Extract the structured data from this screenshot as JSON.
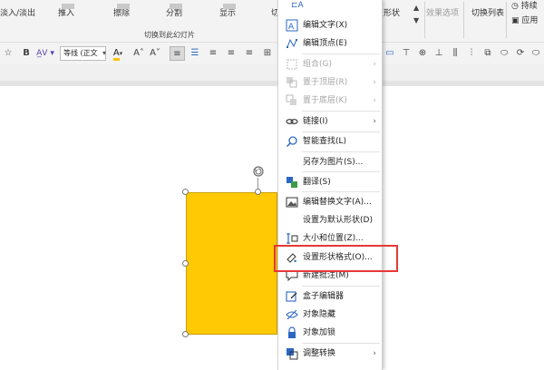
{
  "ribbon": {
    "buttons": [
      "淡入/淡出",
      "推入",
      "擦除",
      "分割",
      "显示",
      "切"
    ],
    "right": {
      "shape_label": "形状",
      "effect_options": "效果选项",
      "switch_list": "切换列表",
      "duration": "持续",
      "apply": "应用"
    },
    "group_label": "切换到此幻灯片"
  },
  "format_bar": {
    "bold": "B",
    "font_name": "等线 (正文",
    "font_color": "A",
    "grow_font": "A˄",
    "shrink_font": "A˅"
  },
  "context_menu": {
    "items": [
      {
        "label": "编辑文字(X)",
        "icon": "edit-text-icon",
        "enabled": true,
        "submenu": false
      },
      {
        "label": "编辑顶点(E)",
        "icon": "edit-points-icon",
        "enabled": true,
        "submenu": false
      },
      {
        "label": "组合(G)",
        "icon": "group-icon",
        "enabled": false,
        "submenu": true
      },
      {
        "label": "置于顶层(R)",
        "icon": "bring-to-front-icon",
        "enabled": false,
        "submenu": true
      },
      {
        "label": "置于底层(K)",
        "icon": "send-to-back-icon",
        "enabled": false,
        "submenu": true
      },
      {
        "label": "链接(I)",
        "icon": "link-icon",
        "enabled": true,
        "submenu": true
      },
      {
        "label": "智能查找(L)",
        "icon": "smart-lookup-icon",
        "enabled": true,
        "submenu": false
      },
      {
        "label": "另存为图片(S)...",
        "icon": "",
        "enabled": true,
        "submenu": false
      },
      {
        "label": "翻译(S)",
        "icon": "translate-icon",
        "enabled": true,
        "submenu": false
      },
      {
        "label": "编辑替换文字(A)...",
        "icon": "alt-text-icon",
        "enabled": true,
        "submenu": false
      },
      {
        "label": "设置为默认形状(D)",
        "icon": "",
        "enabled": true,
        "submenu": false
      },
      {
        "label": "大小和位置(Z)...",
        "icon": "size-position-icon",
        "enabled": true,
        "submenu": false
      },
      {
        "label": "设置形状格式(O)...",
        "icon": "format-shape-icon",
        "enabled": true,
        "submenu": false
      },
      {
        "label": "新建批注(M)",
        "icon": "new-comment-icon",
        "enabled": true,
        "submenu": false
      },
      {
        "label": "盒子编辑器",
        "icon": "box-editor-icon",
        "enabled": true,
        "submenu": false
      },
      {
        "label": "对象隐藏",
        "icon": "hide-object-icon",
        "enabled": true,
        "submenu": false
      },
      {
        "label": "对象加锁",
        "icon": "lock-object-icon",
        "enabled": true,
        "submenu": false
      },
      {
        "label": "调整转换",
        "icon": "convert-icon",
        "enabled": true,
        "submenu": true
      }
    ]
  },
  "colors": {
    "shape_fill": "#ffc904",
    "highlight_border": "#e53935",
    "ribbon_bg": "#f3f3f3"
  }
}
